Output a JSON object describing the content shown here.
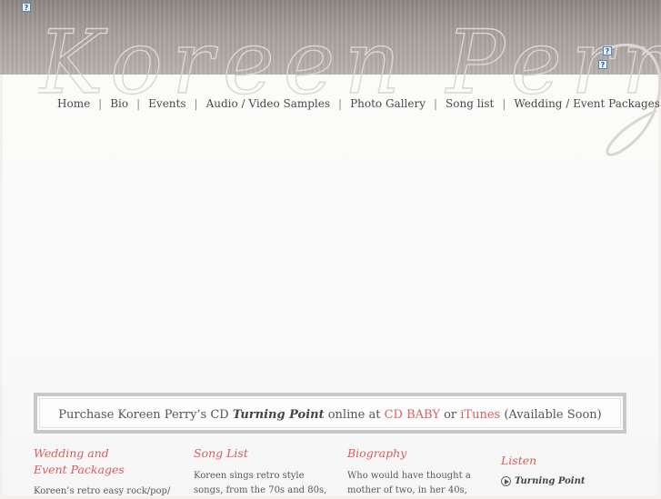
{
  "header": {
    "signature_text": "Koreen Perry",
    "broken_image_glyph": "?"
  },
  "nav": {
    "items": [
      {
        "label": "Home"
      },
      {
        "label": "Bio"
      },
      {
        "label": "Events"
      },
      {
        "label": "Audio / Video Samples"
      },
      {
        "label": "Photo Gallery"
      },
      {
        "label": "Song list"
      },
      {
        "label": "Wedding / Event Packages"
      }
    ],
    "separator": "|"
  },
  "purchase": {
    "prefix": "Purchase Koreen Perry’s CD",
    "album": "Turning Point",
    "middle": "online at",
    "link1": "CD BABY",
    "or": "or",
    "link2": "iTunes",
    "suffix": "(Available Soon)"
  },
  "columns": {
    "wedding": {
      "heading_line1": "Wedding and",
      "heading_line2": "Event Packages",
      "body_line1": "Koreen’s retro easy rock/pop/"
    },
    "songlist": {
      "heading": "Song List",
      "body_line1": "Koreen sings retro style",
      "body_line2": "songs, from the 70s and 80s,"
    },
    "biography": {
      "heading": "Biography",
      "body_line1": "Who would have thought a",
      "body_line2": "mother of two, in her 40s,"
    },
    "listen": {
      "heading": "Listen",
      "item_label": "Turning Point"
    }
  },
  "colors": {
    "accent": "#d85d5d",
    "header_gray": "#a8a19d",
    "text": "#4a4a4a"
  }
}
